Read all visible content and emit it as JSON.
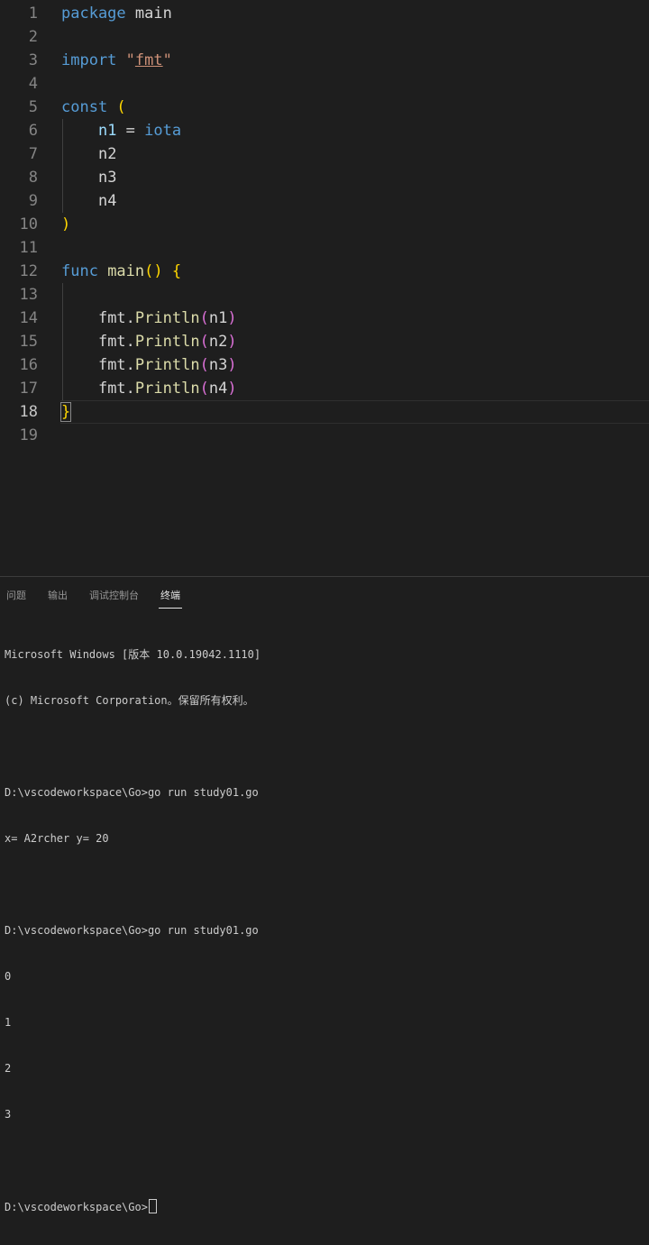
{
  "editor": {
    "line_numbers": [
      "1",
      "2",
      "3",
      "4",
      "5",
      "6",
      "7",
      "8",
      "9",
      "10",
      "11",
      "12",
      "13",
      "14",
      "15",
      "16",
      "17",
      "18",
      "19"
    ],
    "active_line": "18",
    "tokens": {
      "package_kw": "package",
      "main_ident": " main",
      "import_kw": "import",
      "q_open": "\"",
      "fmt_str": "fmt",
      "q_close": "\"",
      "const_kw": "const",
      "paren_open": " (",
      "n1": "n1",
      "assign": " = ",
      "iota": "iota",
      "n2": "n2",
      "n3": "n3",
      "n4": "n4",
      "paren_close": ")",
      "func_kw": "func",
      "main_fn": " main",
      "call_parens": "()",
      "brace_open": " {",
      "brace_close": "}",
      "println_lines": [
        {
          "pkg": "fmt",
          "dot": ".",
          "fn": "Println",
          "lp": "(",
          "arg": "n1",
          "rp": ")"
        },
        {
          "pkg": "fmt",
          "dot": ".",
          "fn": "Println",
          "lp": "(",
          "arg": "n2",
          "rp": ")"
        },
        {
          "pkg": "fmt",
          "dot": ".",
          "fn": "Println",
          "lp": "(",
          "arg": "n3",
          "rp": ")"
        },
        {
          "pkg": "fmt",
          "dot": ".",
          "fn": "Println",
          "lp": "(",
          "arg": "n4",
          "rp": ")"
        }
      ]
    }
  },
  "panel": {
    "tabs": [
      "问题",
      "输出",
      "调试控制台",
      "终端"
    ],
    "active_tab": "终端",
    "terminal_lines": [
      "Microsoft Windows [版本 10.0.19042.1110]",
      "(c) Microsoft Corporation。保留所有权利。",
      "",
      "D:\\vscodeworkspace\\Go>go run study01.go",
      "x= A2rcher y= 20",
      "",
      "D:\\vscodeworkspace\\Go>go run study01.go",
      "0",
      "1",
      "2",
      "3",
      ""
    ],
    "prompt": "D:\\vscodeworkspace\\Go>"
  }
}
